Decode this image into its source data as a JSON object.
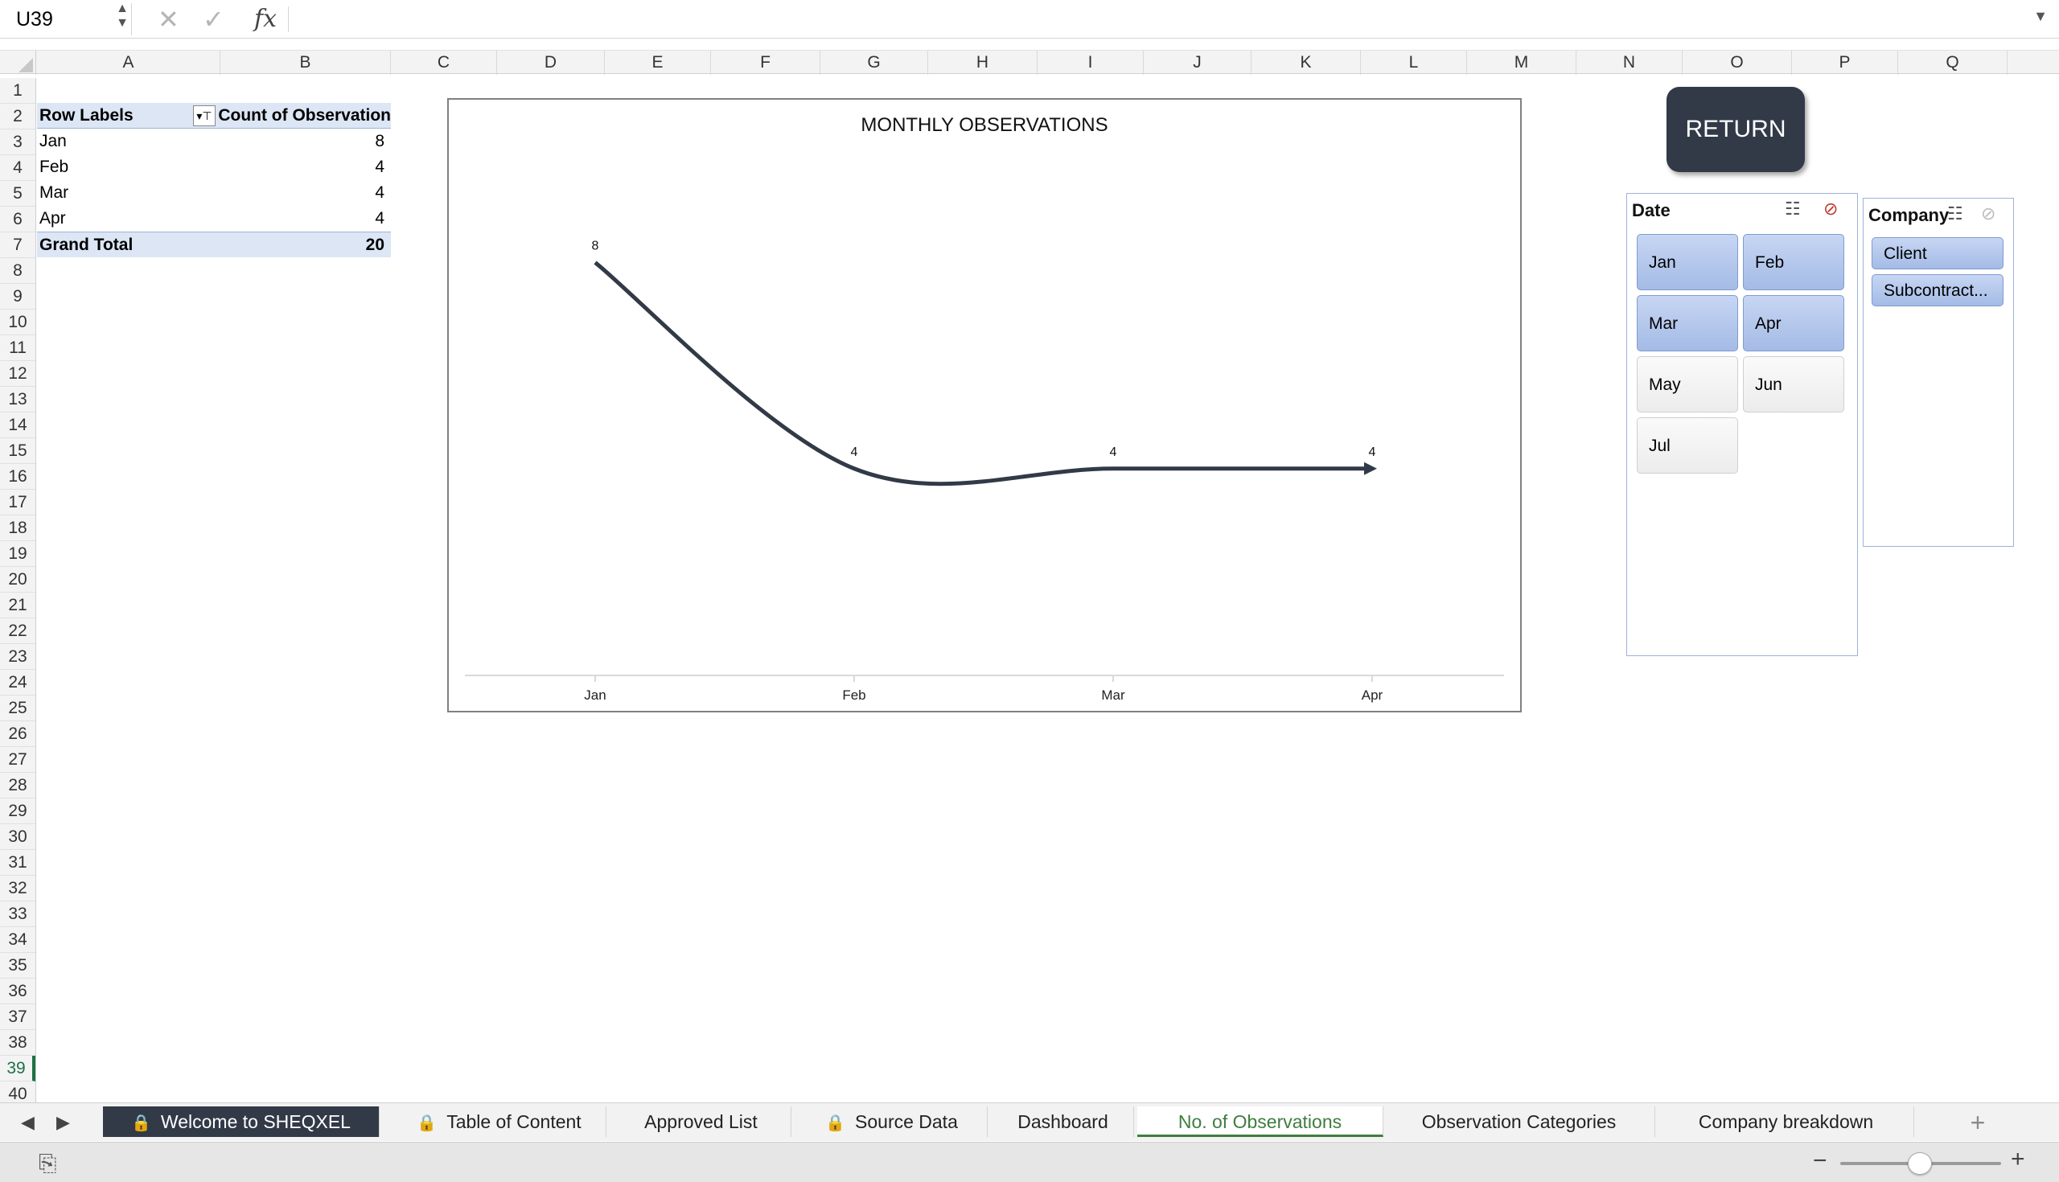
{
  "formula_bar": {
    "cell_ref": "U39",
    "fx_label": "fx",
    "formula": ""
  },
  "columns": [
    "A",
    "B",
    "C",
    "D",
    "E",
    "F",
    "G",
    "H",
    "I",
    "J",
    "K",
    "L",
    "M",
    "N",
    "O",
    "P",
    "Q"
  ],
  "rows": [
    "1",
    "2",
    "3",
    "4",
    "5",
    "6",
    "7",
    "8",
    "9",
    "10",
    "11",
    "12",
    "13",
    "14",
    "15",
    "16",
    "17",
    "18",
    "19",
    "20",
    "21",
    "22",
    "23",
    "24",
    "25",
    "26",
    "27",
    "28",
    "29",
    "30",
    "31",
    "32",
    "33",
    "34",
    "35",
    "36",
    "37",
    "38",
    "39",
    "40"
  ],
  "active_row": "39",
  "pivot": {
    "header_a": "Row Labels",
    "header_b": "Count of Observation",
    "rows": [
      {
        "label": "Jan",
        "value": "8"
      },
      {
        "label": "Feb",
        "value": "4"
      },
      {
        "label": "Mar",
        "value": "4"
      },
      {
        "label": "Apr",
        "value": "4"
      }
    ],
    "total_label": "Grand Total",
    "total_value": "20"
  },
  "chart_data": {
    "type": "line",
    "title": "MONTHLY OBSERVATIONS",
    "categories": [
      "Jan",
      "Feb",
      "Mar",
      "Apr"
    ],
    "values": [
      8,
      4,
      4,
      4
    ],
    "ylim": [
      0,
      9.6
    ],
    "grid": false,
    "legend": "none",
    "smooth": true,
    "line_color": "#323a48"
  },
  "return_button": {
    "label": "RETURN"
  },
  "date_slicer": {
    "title": "Date",
    "items": [
      {
        "label": "Jan",
        "selected": true
      },
      {
        "label": "Feb",
        "selected": true
      },
      {
        "label": "Mar",
        "selected": true
      },
      {
        "label": "Apr",
        "selected": true
      },
      {
        "label": "May",
        "selected": false
      },
      {
        "label": "Jun",
        "selected": false
      },
      {
        "label": "Jul",
        "selected": false
      }
    ]
  },
  "company_slicer": {
    "title": "Company",
    "items": [
      {
        "label": "Client",
        "selected": true
      },
      {
        "label": "Subcontract...",
        "selected": true
      }
    ]
  },
  "sheet_tabs": [
    {
      "label": "Welcome to SHEQXEL",
      "locked": true
    },
    {
      "label": "Table of Content",
      "locked": true
    },
    {
      "label": "Approved List",
      "locked": false
    },
    {
      "label": "Source Data",
      "locked": true
    },
    {
      "label": "Dashboard",
      "locked": false
    },
    {
      "label": "No. of Observations",
      "locked": false
    },
    {
      "label": "Observation Categories",
      "locked": false
    },
    {
      "label": "Company breakdown",
      "locked": false
    }
  ],
  "add_sheet_label": "+",
  "colors": {
    "accent_green": "#3f7d3f",
    "dark_navy": "#323a48",
    "pivot_highlight": "#dce6f5",
    "slicer_selected": "#a4bbe6"
  }
}
